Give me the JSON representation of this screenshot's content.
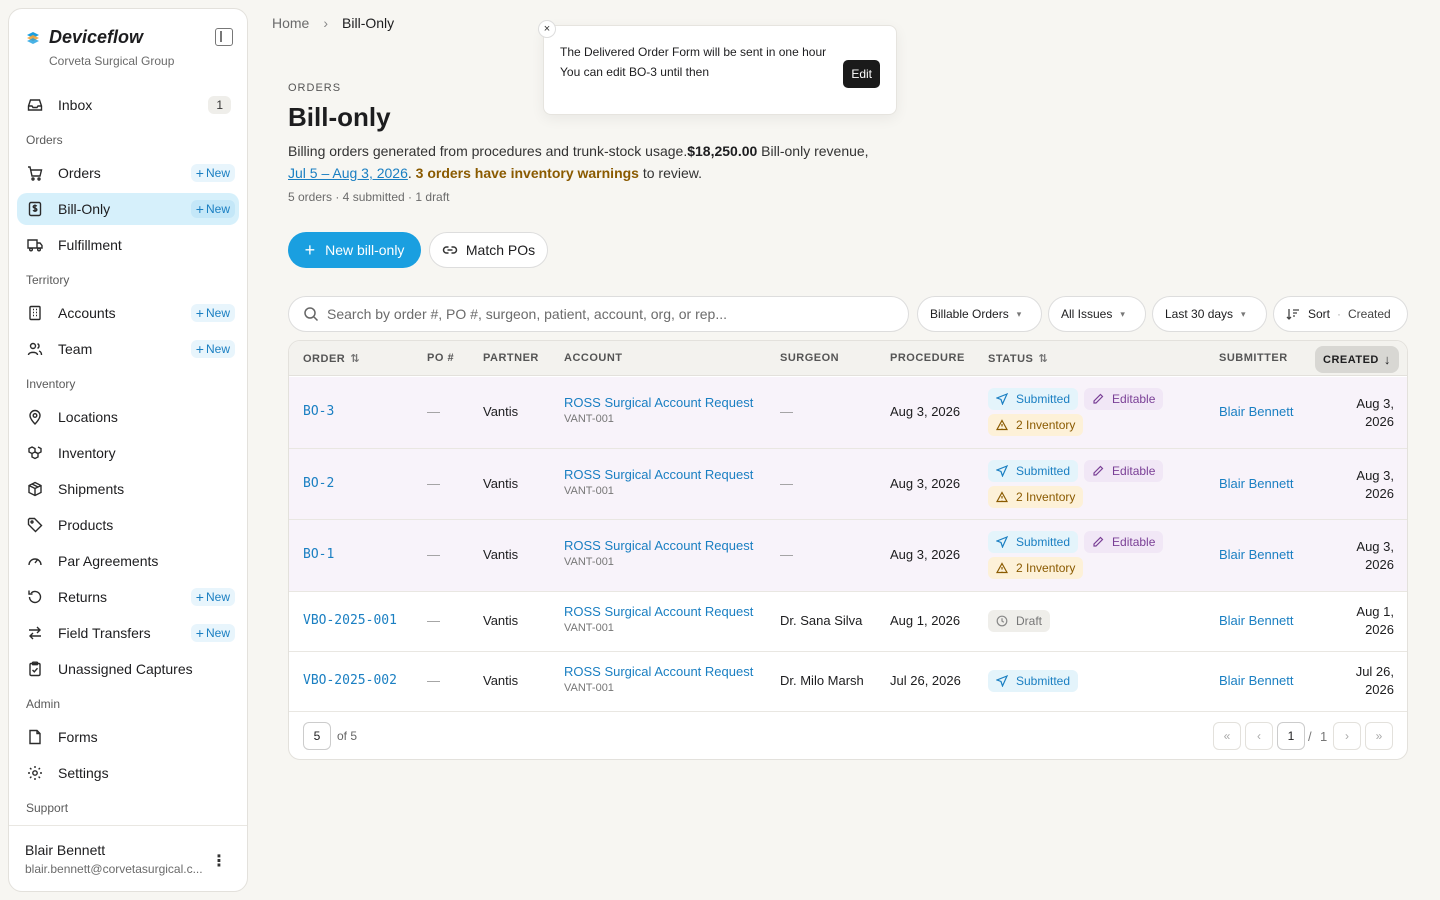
{
  "sidebar": {
    "brand": "Deviceflow",
    "org": "Corveta Surgical Group",
    "inbox": {
      "label": "Inbox",
      "count": "1"
    },
    "sections": {
      "orders": "Orders",
      "territory": "Territory",
      "inventory": "Inventory",
      "admin": "Admin",
      "support": "Support"
    },
    "items": {
      "orders": "Orders",
      "bill_only": "Bill-Only",
      "fulfillment": "Fulfillment",
      "accounts": "Accounts",
      "team": "Team",
      "locations": "Locations",
      "inventory": "Inventory",
      "shipments": "Shipments",
      "products": "Products",
      "par_agreements": "Par Agreements",
      "returns": "Returns",
      "field_transfers": "Field Transfers",
      "unassigned_captures": "Unassigned Captures",
      "forms": "Forms",
      "settings": "Settings"
    },
    "new_label": "New",
    "user": {
      "name": "Blair Bennett",
      "email": "blair.bennett@corvetasurgical.c..."
    }
  },
  "breadcrumb": {
    "home": "Home",
    "current": "Bill-Only"
  },
  "toast": {
    "line1": "The Delivered Order Form will be sent in one hour",
    "line2": "You can edit BO-3 until then",
    "edit": "Edit",
    "close": "×"
  },
  "header": {
    "eyebrow": "ORDERS",
    "title": "Bill-only",
    "desc_intro": "Billing orders generated from procedures and trunk-stock usage.",
    "revenue": "$18,250.00",
    "revenue_label": " Bill-only revenue, ",
    "range": "Jul 5 – Aug 3, 2026",
    "period": ". ",
    "warnings": "3 orders have inventory warnings",
    "to_review": " to review.",
    "counts": "5 orders · 4 submitted · 1 draft"
  },
  "actions": {
    "new_bill_only": "New bill-only",
    "match_pos": "Match POs"
  },
  "search": {
    "placeholder": "Search by order #, PO #, surgeon, patient, account, org, or rep..."
  },
  "filters": {
    "billable": "Billable Orders",
    "issues": "All Issues",
    "range": "Last 30 days",
    "sort": "Sort",
    "sort_value": "Created"
  },
  "table": {
    "headers": {
      "order": "ORDER",
      "po": "PO #",
      "partner": "PARTNER",
      "account": "ACCOUNT",
      "surgeon": "SURGEON",
      "procedure": "PROCEDURE",
      "status": "STATUS",
      "submitter": "SUBMITTER",
      "created": "CREATED"
    },
    "rows": [
      {
        "order": "BO-3",
        "po": "—",
        "partner": "Vantis",
        "account": "ROSS Surgical Account Request",
        "account_code": "VANT-001",
        "surgeon": "—",
        "procedure": "Aug 3, 2026",
        "status": "Submitted",
        "editable": "Editable",
        "inventory": "2 Inventory",
        "submitter": "Blair Bennett",
        "created_1": "Aug 3,",
        "created_2": "2026"
      },
      {
        "order": "BO-2",
        "po": "—",
        "partner": "Vantis",
        "account": "ROSS Surgical Account Request",
        "account_code": "VANT-001",
        "surgeon": "—",
        "procedure": "Aug 3, 2026",
        "status": "Submitted",
        "editable": "Editable",
        "inventory": "2 Inventory",
        "submitter": "Blair Bennett",
        "created_1": "Aug 3,",
        "created_2": "2026"
      },
      {
        "order": "BO-1",
        "po": "—",
        "partner": "Vantis",
        "account": "ROSS Surgical Account Request",
        "account_code": "VANT-001",
        "surgeon": "—",
        "procedure": "Aug 3, 2026",
        "status": "Submitted",
        "editable": "Editable",
        "inventory": "2 Inventory",
        "submitter": "Blair Bennett",
        "created_1": "Aug 3,",
        "created_2": "2026"
      },
      {
        "order": "VBO-2025-001",
        "po": "—",
        "partner": "Vantis",
        "account": "ROSS Surgical Account Request",
        "account_code": "VANT-001",
        "surgeon": "Dr. Sana Silva",
        "procedure": "Aug 1, 2026",
        "status": "Draft",
        "submitter": "Blair Bennett",
        "created_1": "Aug 1,",
        "created_2": "2026"
      },
      {
        "order": "VBO-2025-002",
        "po": "—",
        "partner": "Vantis",
        "account": "ROSS Surgical Account Request",
        "account_code": "VANT-001",
        "surgeon": "Dr. Milo Marsh",
        "procedure": "Jul 26, 2026",
        "status": "Submitted",
        "submitter": "Blair Bennett",
        "created_1": "Jul 26,",
        "created_2": "2026"
      }
    ]
  },
  "pagination": {
    "page_size": "5",
    "of_total": "of 5",
    "current": "1",
    "slash": "/",
    "total_pages": "1"
  },
  "colors": {
    "accent": "#1a9fe0",
    "link": "#1a7fc2",
    "active_nav": "#d6f0fb",
    "warning": "#8a5a00"
  }
}
